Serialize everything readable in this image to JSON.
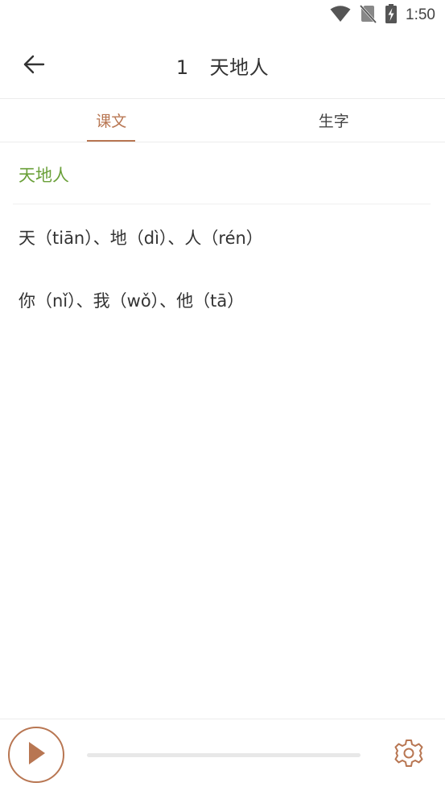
{
  "status_bar": {
    "time": "1:50",
    "icons": [
      "wifi-icon",
      "no-sim-icon",
      "battery-charging-icon"
    ]
  },
  "app_bar": {
    "back_icon": "arrow-left-icon",
    "lesson_number": "1",
    "lesson_title": "天地人"
  },
  "tabs": [
    {
      "label": "课文",
      "active": true
    },
    {
      "label": "生字",
      "active": false
    }
  ],
  "content": {
    "heading": "天地人",
    "lines": [
      "天（tiān）、地（dì）、人（rén）",
      "你（nǐ）、我（wǒ）、他（tā）"
    ]
  },
  "player": {
    "play_icon": "play-icon",
    "progress": 0,
    "settings_icon": "gear-icon"
  },
  "colors": {
    "accent": "#b87652",
    "heading_green": "#6aa039",
    "text": "#333333"
  }
}
